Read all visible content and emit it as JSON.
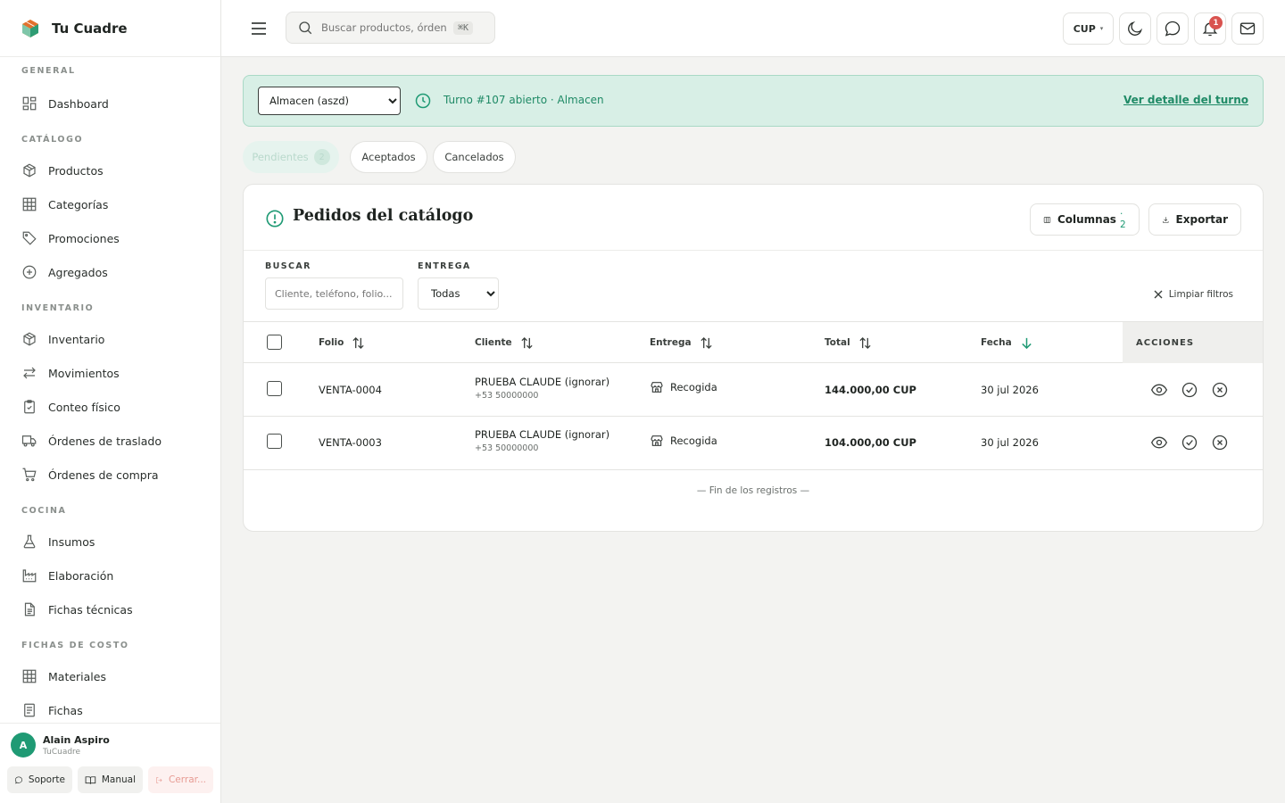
{
  "brand": {
    "name": "Tu Cuadre"
  },
  "sidebar": {
    "sections": [
      {
        "label": "GENERAL",
        "items": [
          {
            "label": "Dashboard",
            "icon": "dashboard-icon"
          }
        ]
      },
      {
        "label": "CATÁLOGO",
        "items": [
          {
            "label": "Productos",
            "icon": "box-icon"
          },
          {
            "label": "Categorías",
            "icon": "grid-icon"
          },
          {
            "label": "Promociones",
            "icon": "tag-icon"
          },
          {
            "label": "Agregados",
            "icon": "plus-circle-icon"
          }
        ]
      },
      {
        "label": "INVENTARIO",
        "items": [
          {
            "label": "Inventario",
            "icon": "box-icon"
          },
          {
            "label": "Movimientos",
            "icon": "arrows-icon"
          },
          {
            "label": "Conteo físico",
            "icon": "clipboard-check-icon"
          },
          {
            "label": "Órdenes de traslado",
            "icon": "truck-icon"
          },
          {
            "label": "Órdenes de compra",
            "icon": "cart-icon"
          }
        ]
      },
      {
        "label": "COCINA",
        "items": [
          {
            "label": "Insumos",
            "icon": "flask-icon"
          },
          {
            "label": "Elaboración",
            "icon": "factory-icon"
          },
          {
            "label": "Fichas técnicas",
            "icon": "document-icon"
          }
        ]
      },
      {
        "label": "FICHAS DE COSTO",
        "items": [
          {
            "label": "Materiales",
            "icon": "grid-icon"
          },
          {
            "label": "Fichas",
            "icon": "list-document-icon"
          }
        ]
      }
    ]
  },
  "user": {
    "initial": "A",
    "name": "Alain Aspiro",
    "org": "TuCuadre",
    "support_label": "Soporte",
    "manual_label": "Manual",
    "logout_label": "Cerrar..."
  },
  "topbar": {
    "search_placeholder": "Buscar productos, órdenes...",
    "shortcut": "⌘K",
    "currency": "CUP",
    "notification_count": "1"
  },
  "shift": {
    "warehouse_options": [
      "Almacen (aszd)"
    ],
    "selected_warehouse": "Almacen (aszd)",
    "status_text": "Turno #107 abierto · Almacen",
    "detail_link": "Ver detalle del turno"
  },
  "tabs": [
    {
      "label": "Pendientes",
      "count": "2",
      "active": true
    },
    {
      "label": "Aceptados"
    },
    {
      "label": "Cancelados"
    }
  ],
  "orders": {
    "title": "Pedidos del catálogo",
    "columns_button": "Columnas",
    "columns_count": "· 2",
    "export_button": "Exportar",
    "filters": {
      "search_label": "BUSCAR",
      "search_placeholder": "Cliente, teléfono, folio...",
      "delivery_label": "ENTREGA",
      "delivery_options": [
        "Todas"
      ],
      "delivery_selected": "Todas",
      "clear_label": "Limpiar filtros"
    },
    "headers": {
      "folio": "Folio",
      "client": "Cliente",
      "delivery": "Entrega",
      "total": "Total",
      "date": "Fecha",
      "actions": "ACCIONES"
    },
    "rows": [
      {
        "folio": "VENTA-0004",
        "client": "PRUEBA CLAUDE (ignorar)",
        "phone": "+53 50000000",
        "delivery": "Recogida",
        "total": "144.000,00 CUP",
        "date": "30 jul 2026"
      },
      {
        "folio": "VENTA-0003",
        "client": "PRUEBA CLAUDE (ignorar)",
        "phone": "+53 50000000",
        "delivery": "Recogida",
        "total": "104.000,00 CUP",
        "date": "30 jul 2026"
      }
    ],
    "end_text": "— Fin de los registros —"
  },
  "colors": {
    "accent": "#1f9a74",
    "banner_bg": "#d8efe6",
    "badge": "#d9534f"
  }
}
